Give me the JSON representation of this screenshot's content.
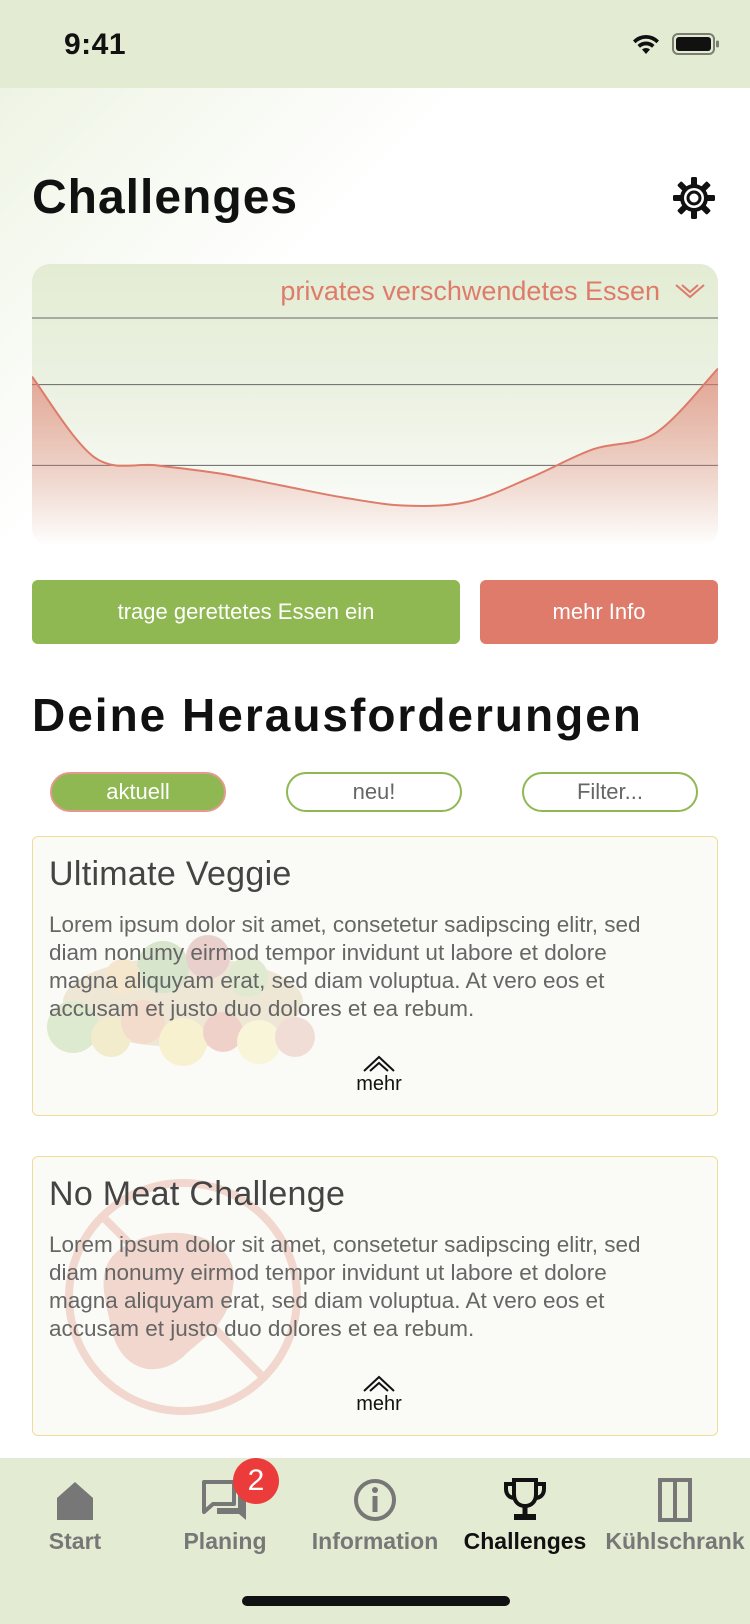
{
  "status": {
    "time": "9:41"
  },
  "header": {
    "title": "Challenges",
    "settings_icon": "gear-icon"
  },
  "chart": {
    "selector_label": "privates verschwendetes Essen",
    "line_color": "#de7b6a",
    "fill_color": "#de7b6a",
    "bg_color": "#e3ecd3"
  },
  "chart_data": {
    "type": "area",
    "title": "",
    "xlabel": "",
    "ylabel": "",
    "ylim": [
      0,
      3
    ],
    "grid": true,
    "series": [
      {
        "values": [
          2.1,
          1.1,
          1.0,
          0.9,
          0.75,
          0.6,
          0.5,
          0.55,
          0.85,
          1.2,
          1.4,
          2.2
        ]
      }
    ]
  },
  "actions": {
    "save_food_label": "trage gerettetes Essen ein",
    "more_info_label": "mehr Info"
  },
  "section": {
    "title": "Deine Herausforderungen"
  },
  "filters": [
    {
      "label": "aktuell",
      "active": true
    },
    {
      "label": "neu!",
      "active": false
    },
    {
      "label": "Filter...",
      "active": false
    }
  ],
  "cards": [
    {
      "title": "Ultimate Veggie",
      "text": "Lorem ipsum dolor sit amet, consetetur sadipscing elitr, sed diam nonumy eirmod tempor invidunt ut labore et dolore magna aliquyam erat, sed diam voluptua. At vero eos et accusam et justo duo dolores et ea rebum.",
      "more_label": "mehr",
      "art": "vegetables-image"
    },
    {
      "title": "No Meat Challenge",
      "text": "Lorem ipsum dolor sit amet, consetetur sadipscing elitr, sed diam nonumy eirmod tempor invidunt ut labore et dolore magna aliquyam erat, sed diam voluptua. At vero eos et accusam et justo duo dolores et ea rebum.",
      "more_label": "mehr",
      "art": "no-meat-icon"
    }
  ],
  "tabbar": {
    "items": [
      {
        "label": "Start",
        "icon": "home-icon",
        "active": false
      },
      {
        "label": "Planing",
        "icon": "chat-icon",
        "active": false,
        "badge": "2"
      },
      {
        "label": "Information",
        "icon": "info-icon",
        "active": false
      },
      {
        "label": "Challenges",
        "icon": "trophy-icon",
        "active": true
      },
      {
        "label": "Kühlschrank",
        "icon": "fridge-icon",
        "active": false
      }
    ]
  }
}
